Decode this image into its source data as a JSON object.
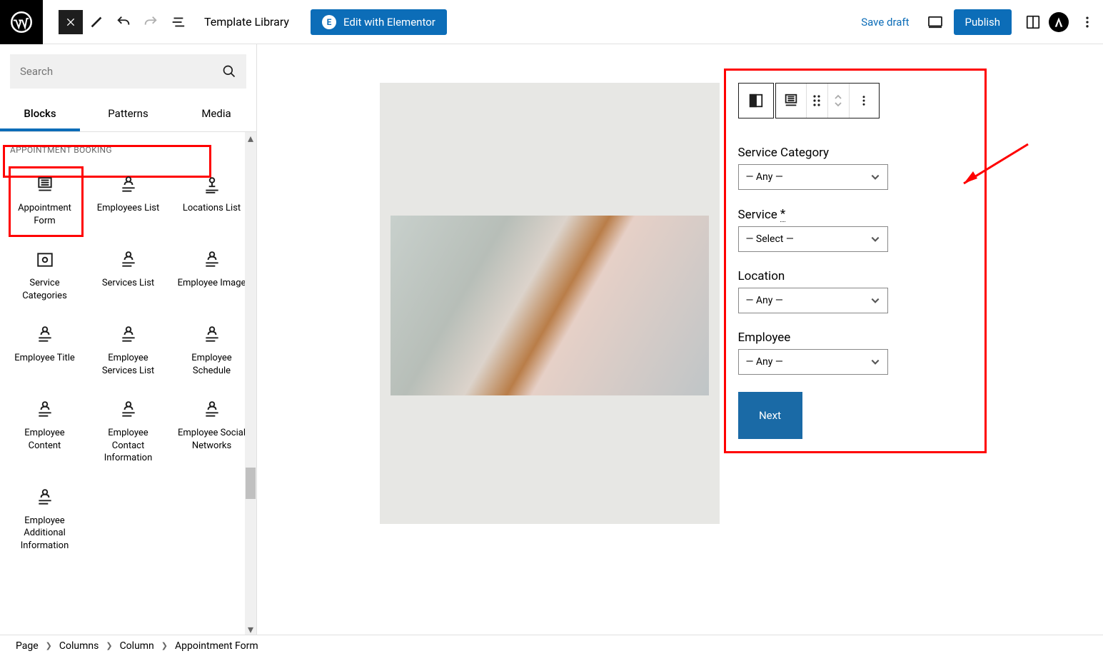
{
  "topbar": {
    "template_library": "Template Library",
    "elementor": "Edit with Elementor",
    "save_draft": "Save draft",
    "publish": "Publish"
  },
  "sidebar": {
    "search_placeholder": "Search",
    "tabs": {
      "blocks": "Blocks",
      "patterns": "Patterns",
      "media": "Media"
    },
    "category": "APPOINTMENT BOOKING",
    "blocks": [
      {
        "label": "Appointment Form"
      },
      {
        "label": "Employees List"
      },
      {
        "label": "Locations List"
      },
      {
        "label": "Service Categories"
      },
      {
        "label": "Services List"
      },
      {
        "label": "Employee Image"
      },
      {
        "label": "Employee Title"
      },
      {
        "label": "Employee Services List"
      },
      {
        "label": "Employee Schedule"
      },
      {
        "label": "Employee Content"
      },
      {
        "label": "Employee Contact Information"
      },
      {
        "label": "Employee Social Networks"
      },
      {
        "label": "Employee Additional Information"
      }
    ]
  },
  "form": {
    "fields": [
      {
        "label": "Service Category",
        "value": "— Any —",
        "required": false
      },
      {
        "label": "Service",
        "value": "— Select —",
        "required": true
      },
      {
        "label": "Location",
        "value": "— Any —",
        "required": false
      },
      {
        "label": "Employee",
        "value": "— Any —",
        "required": false
      }
    ],
    "required_mark": "*",
    "next": "Next"
  },
  "breadcrumb": [
    "Page",
    "Columns",
    "Column",
    "Appointment Form"
  ]
}
